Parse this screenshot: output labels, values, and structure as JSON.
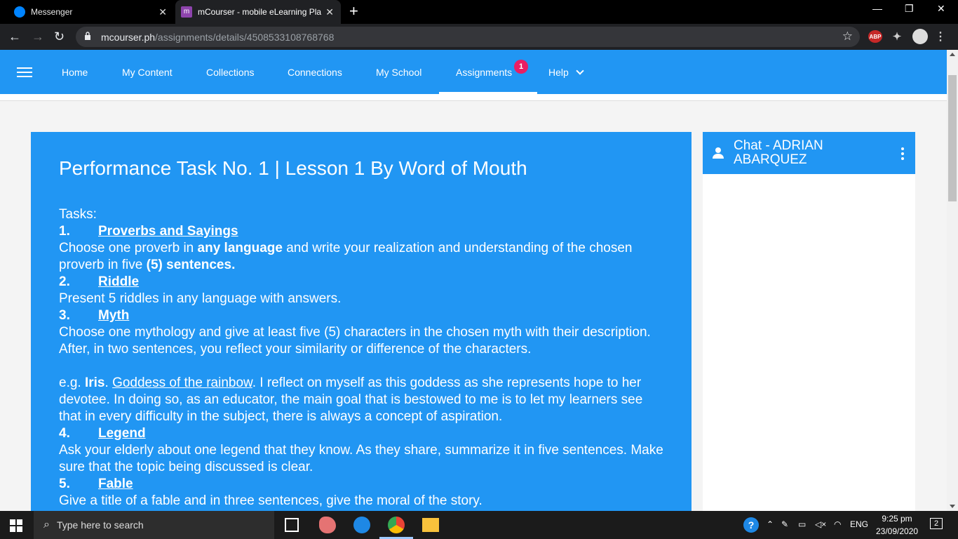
{
  "browser": {
    "tabs": [
      {
        "label": "Messenger",
        "icon": "messenger-icon",
        "active": false
      },
      {
        "label": "mCourser - mobile eLearning Pla",
        "icon": "mcourser-icon",
        "active": true
      }
    ],
    "url_host": "mcourser.ph",
    "url_path": "/assignments/details/4508533108768768",
    "ext_abp": "ABP"
  },
  "nav": {
    "items": [
      "Home",
      "My Content",
      "Collections",
      "Connections",
      "My School",
      "Assignments",
      "Help"
    ],
    "active": "Assignments",
    "badge": "1",
    "accent": "#2196f3",
    "badge_color": "#e91e63"
  },
  "task": {
    "title": "Performance Task No. 1 | Lesson 1 By Word of Mouth",
    "tasks_label": "Tasks:",
    "items": [
      {
        "num": "1.",
        "heading": "Proverbs and Sayings"
      },
      {
        "num": "2.",
        "heading": "Riddle",
        "text": "Present 5 riddles in any language with answers."
      },
      {
        "num": "3.",
        "heading": "Myth",
        "text": "Choose one mythology and give at least five (5) characters in the chosen myth with their description. After, in two sentences, you reflect your similarity or difference of the characters."
      },
      {
        "num": "4.",
        "heading": "Legend",
        "text": "Ask your elderly about one legend that they know. As they share, summarize it in five sentences. Make sure that the topic being discussed is clear."
      },
      {
        "num": "5.",
        "heading": "Fable",
        "text": "Give a title of a fable and in three sentences, give the moral of the story."
      }
    ],
    "p1": {
      "a": "Choose one proverb in ",
      "b": "any language",
      "c": " and write your realization and understanding of the chosen proverb in five ",
      "d": "(5) sentences."
    },
    "example": {
      "prefix": "e.g.  ",
      "name": "Iris",
      "dot": ". ",
      "link": "Goddess of the rainbow",
      "rest": ". I reflect on myself as this goddess as she represents hope to her devotee. In doing so, as an educator, the main goal that is bestowed to me is to let my learners see that in every difficulty in the subject, there is always a concept of aspiration."
    }
  },
  "chat": {
    "title": "Chat - ADRIAN ABARQUEZ"
  },
  "taskbar": {
    "search_placeholder": "Type here to search",
    "lang": "ENG",
    "time": "9:25 pm",
    "date": "23/09/2020",
    "notifications": "2"
  }
}
